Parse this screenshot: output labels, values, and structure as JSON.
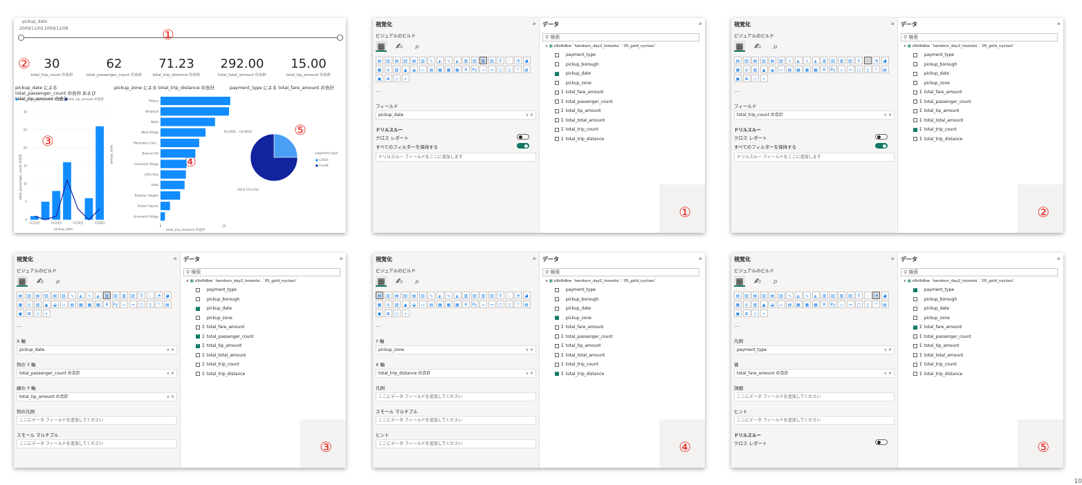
{
  "report": {
    "slicer_label": "pickup_date",
    "date_from": "2009/11/02",
    "date_to": "2009/11/08",
    "kpis": [
      {
        "value": "30",
        "label": "total_trip_count の合計"
      },
      {
        "value": "62",
        "label": "total_passenger_count の合計"
      },
      {
        "value": "71.23",
        "label": "total_trip_distance の合計"
      },
      {
        "value": "292.00",
        "label": "total_total_amount の合計"
      },
      {
        "value": "15.00",
        "label": "total_tip_amount の合計"
      }
    ],
    "combo_title": "pickup_date による total_passenger_count の合計 および total_tip_amount の合計",
    "combo_legend": [
      "total_passenger_count の合計",
      "total_tip_amount の合計"
    ],
    "combo_ylabel": "total_passenger_count の合計",
    "combo_xlabel": "pickup_date",
    "bar_title": "pickup_zone による total_trip_distance の合計",
    "bar_ylabel": "pickup_zone",
    "bar_xlabel": "total_trip_distance の合計",
    "pie_title": "payment_type による total_fare_amount の合計",
    "pie_legend_title": "payment_type",
    "pie_labels": [
      "63.4000... (24.86%)",
      "191.6 (75.14%)"
    ],
    "circle_labels": [
      "①",
      "②",
      "③",
      "④",
      "⑤"
    ]
  },
  "chart_data": [
    {
      "type": "bar",
      "title": "pickup_date による total_passenger_count の合計 および total_tip_amount の合計",
      "xlabel": "pickup_date",
      "ylabel": "total_passenger_count の合計",
      "categories": [
        "11月2日",
        "",
        "11月4日",
        "",
        "11月6日",
        "",
        "11月8日"
      ],
      "ylim": [
        0,
        30
      ],
      "series": [
        {
          "name": "total_passenger_count の合計",
          "type": "bar",
          "values": [
            1,
            5,
            8,
            16,
            0,
            6,
            26
          ]
        },
        {
          "name": "total_tip_amount の合計",
          "type": "line",
          "values": [
            1,
            0,
            1,
            11,
            3,
            0,
            3
          ]
        }
      ]
    },
    {
      "type": "bar",
      "title": "pickup_zone による total_trip_distance の合計",
      "xlabel": "total_trip_distance の合計",
      "ylabel": "pickup_zone",
      "categories": [
        "Tribeca",
        "Whitehall",
        "NoHo",
        "West Village",
        "Manhattan Com...",
        "Boerum Hill",
        "University Village",
        "Little Italy",
        "SoHo",
        "Brooklyn Heights",
        "Hudson Square",
        "Greenwich Village"
      ],
      "values": [
        11,
        10.8,
        8.6,
        7.1,
        6.1,
        5.5,
        4.1,
        4,
        3.8,
        3.1,
        1.5,
        0.7
      ],
      "xlim": [
        0,
        12
      ],
      "ticks": [
        "0",
        "10"
      ]
    },
    {
      "type": "pie",
      "title": "payment_type による total_fare_amount の合計",
      "categories": [
        "CASH",
        "Credit"
      ],
      "values": [
        63.4,
        191.6
      ],
      "percent": [
        24.86,
        75.14
      ]
    }
  ],
  "viz_pane": {
    "title": "視覚化",
    "build": "ビジュアルのビルド",
    "more": "...",
    "drill": "ドリルスルー",
    "cross_report": "クロス レポート",
    "keep_filters": "すべてのフィルターを保持する",
    "drill_placeholder": "ドリルスルー フィールドをここに追加します",
    "add_field": "ここにデータ フィールドを追加してください"
  },
  "data_pane": {
    "title": "データ",
    "search": "検索",
    "table": "o9o9dbw `handson_day2_toooota`.`05_gold_nyctaxi`",
    "fields": [
      "payment_type",
      "pickup_borough",
      "pickup_date",
      "pickup_zone",
      "total_fare_amount",
      "total_passenger_count",
      "total_tip_amount",
      "total_total_amount",
      "total_trip_count",
      "total_trip_distance"
    ]
  },
  "panels": [
    {
      "num": "①",
      "wells": [
        {
          "label": "フィールド",
          "value": "pickup_date"
        }
      ],
      "checked": [
        2
      ]
    },
    {
      "num": "②",
      "wells": [
        {
          "label": "フィールド",
          "value": "total_trip_count の合計"
        }
      ],
      "checked": [
        8
      ]
    },
    {
      "num": "③",
      "wells": [
        {
          "label": "X 軸",
          "value": "pickup_date"
        },
        {
          "label": "列の Y 軸",
          "value": "total_passenger_count の合計"
        },
        {
          "label": "線の Y 軸",
          "value": "total_tip_amount の合計"
        },
        {
          "label": "列の凡例",
          "value": ""
        },
        {
          "label": "スモール マルチプル",
          "value": ""
        }
      ],
      "checked": [
        2,
        5,
        6
      ]
    },
    {
      "num": "④",
      "wells": [
        {
          "label": "Y 軸",
          "value": "pickup_zone"
        },
        {
          "label": "X 軸",
          "value": "total_trip_distance の合計"
        },
        {
          "label": "凡例",
          "value": ""
        },
        {
          "label": "スモール マルチプル",
          "value": ""
        },
        {
          "label": "ヒント",
          "value": ""
        }
      ],
      "checked": [
        3,
        9
      ]
    },
    {
      "num": "⑤",
      "wells": [
        {
          "label": "凡例",
          "value": "payment_type"
        },
        {
          "label": "値",
          "value": "total_fare_amount の合計"
        },
        {
          "label": "詳細",
          "value": ""
        },
        {
          "label": "ヒント",
          "value": ""
        }
      ],
      "checked": [
        0,
        4
      ]
    }
  ],
  "page_number": "10",
  "colors": {
    "accent": "#117865",
    "bar": "#118dff",
    "dark": "#12239e",
    "marker": "#e8261f"
  }
}
